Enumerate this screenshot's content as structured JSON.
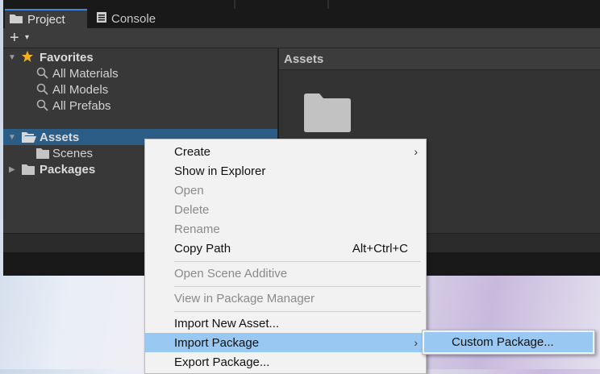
{
  "tabs": [
    {
      "label": "Project",
      "icon": "folder-icon",
      "active": true
    },
    {
      "label": "Console",
      "icon": "console-icon",
      "active": false
    }
  ],
  "toolbar": {
    "add_label": "+",
    "add_dropdown": "▾"
  },
  "tree": {
    "favorites": {
      "label": "Favorites",
      "items": [
        "All Materials",
        "All Models",
        "All Prefabs"
      ]
    },
    "assets": {
      "label": "Assets",
      "children": [
        "Scenes"
      ]
    },
    "packages": {
      "label": "Packages"
    }
  },
  "right_panel": {
    "header": "Assets"
  },
  "context_menu": {
    "items": [
      {
        "label": "Create",
        "enabled": true,
        "submenu": true
      },
      {
        "label": "Show in Explorer",
        "enabled": true
      },
      {
        "label": "Open",
        "enabled": false
      },
      {
        "label": "Delete",
        "enabled": false
      },
      {
        "label": "Rename",
        "enabled": false
      },
      {
        "label": "Copy Path",
        "enabled": true,
        "shortcut": "Alt+Ctrl+C"
      },
      {
        "label": "Open Scene Additive",
        "enabled": false
      },
      {
        "label": "View in Package Manager",
        "enabled": false
      },
      {
        "label": "Import New Asset...",
        "enabled": true
      },
      {
        "label": "Import Package",
        "enabled": true,
        "submenu": true,
        "highlighted": true
      },
      {
        "label": "Export Package...",
        "enabled": true
      }
    ]
  },
  "submenu": {
    "items": [
      {
        "label": "Custom Package...",
        "highlighted": true
      }
    ]
  },
  "colors": {
    "accent": "#3d86d8",
    "selection": "#2c5d87",
    "menu_highlight": "#99c9f2",
    "star": "#f2b01e"
  }
}
